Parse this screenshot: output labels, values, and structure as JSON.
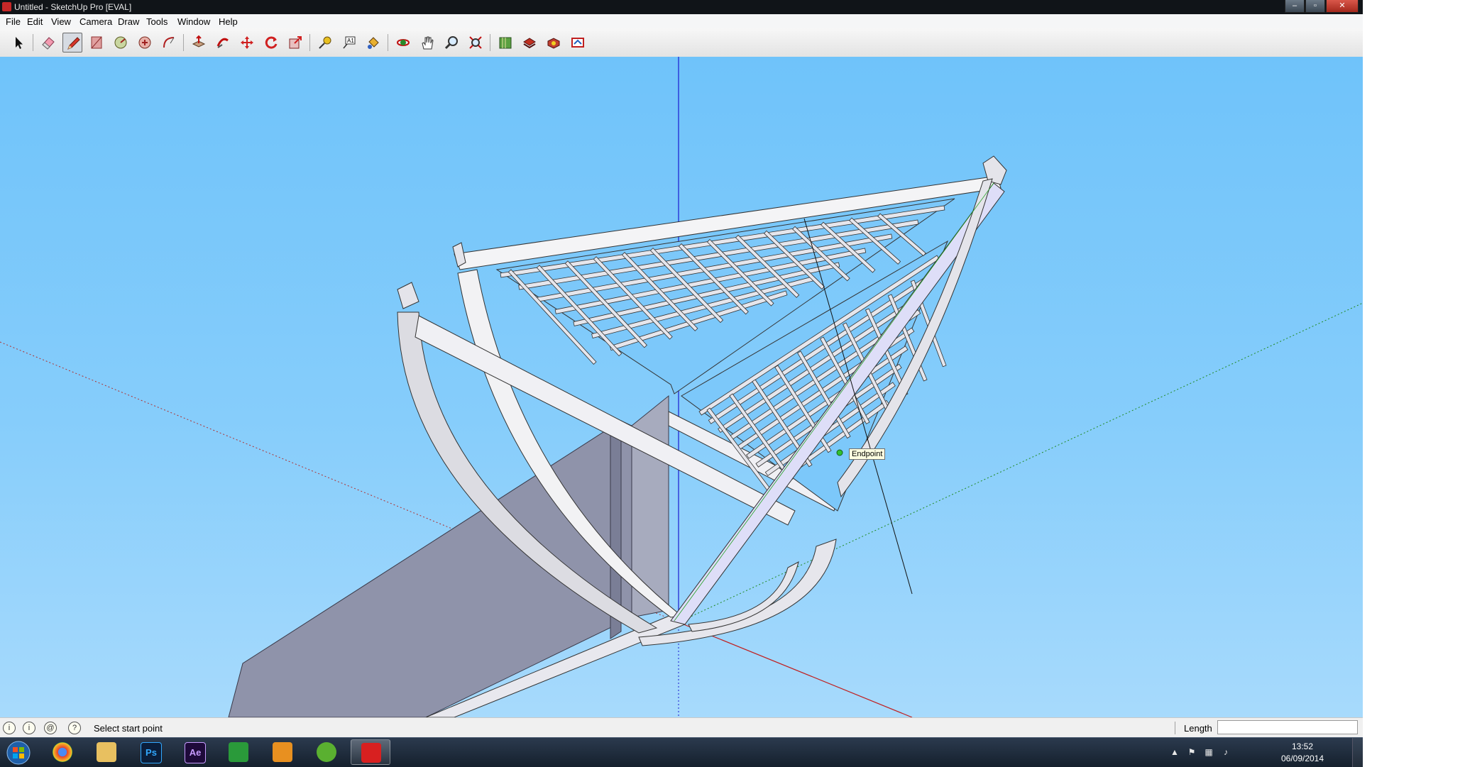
{
  "window": {
    "title": "Untitled - SketchUp Pro [EVAL]",
    "controls": {
      "minimize": "–",
      "maximize": "▫",
      "close": "✕"
    }
  },
  "menu": [
    "File",
    "Edit",
    "View",
    "Camera",
    "Draw",
    "Tools",
    "Window",
    "Help"
  ],
  "toolbar": {
    "tools": [
      {
        "name": "select-tool",
        "icon": "arrow-icon"
      },
      {
        "name": "eraser-tool",
        "icon": "eraser-icon"
      },
      {
        "name": "line-tool",
        "icon": "pencil-icon",
        "active": true
      },
      {
        "name": "rectangle-tool",
        "icon": "rectangle-icon"
      },
      {
        "name": "circle-tool",
        "icon": "circle-icon"
      },
      {
        "name": "polygon-tool",
        "icon": "polygon-icon"
      },
      {
        "name": "arc-tool",
        "icon": "arc-icon"
      },
      {
        "name": "push-pull-tool",
        "icon": "push-pull-icon"
      },
      {
        "name": "follow-me-tool",
        "icon": "follow-me-icon"
      },
      {
        "name": "move-tool",
        "icon": "move-icon"
      },
      {
        "name": "rotate-tool",
        "icon": "rotate-icon"
      },
      {
        "name": "scale-tool",
        "icon": "scale-icon"
      },
      {
        "name": "tape-measure-tool",
        "icon": "tape-measure-icon"
      },
      {
        "name": "text-tool",
        "icon": "text-icon"
      },
      {
        "name": "paint-bucket-tool",
        "icon": "paint-bucket-icon"
      },
      {
        "name": "orbit-tool",
        "icon": "orbit-icon"
      },
      {
        "name": "pan-tool",
        "icon": "hand-icon"
      },
      {
        "name": "zoom-tool",
        "icon": "magnifier-icon"
      },
      {
        "name": "zoom-extents-tool",
        "icon": "zoom-extents-icon"
      },
      {
        "name": "warehouse-tool",
        "icon": "warehouse-icon"
      },
      {
        "name": "share-model-tool",
        "icon": "share-model-icon"
      },
      {
        "name": "components-tool",
        "icon": "components-icon"
      },
      {
        "name": "extension-tool",
        "icon": "extension-icon"
      }
    ]
  },
  "viewport": {
    "sky_color": "#77c7fa",
    "inference_tooltip": "Endpoint"
  },
  "status": {
    "message": "Select start point",
    "vcb_label": "Length",
    "vcb_value": ""
  },
  "taskbar": {
    "apps": [
      {
        "name": "chrome",
        "label": ""
      },
      {
        "name": "explorer",
        "label": ""
      },
      {
        "name": "photoshop",
        "label": "Ps"
      },
      {
        "name": "after-effects",
        "label": "Ae"
      },
      {
        "name": "app-green",
        "label": ""
      },
      {
        "name": "media-player",
        "label": ""
      },
      {
        "name": "utorrent",
        "label": ""
      },
      {
        "name": "sketchup",
        "label": "",
        "active": true
      }
    ],
    "clock_time": "13:52",
    "clock_date": "06/09/2014"
  }
}
